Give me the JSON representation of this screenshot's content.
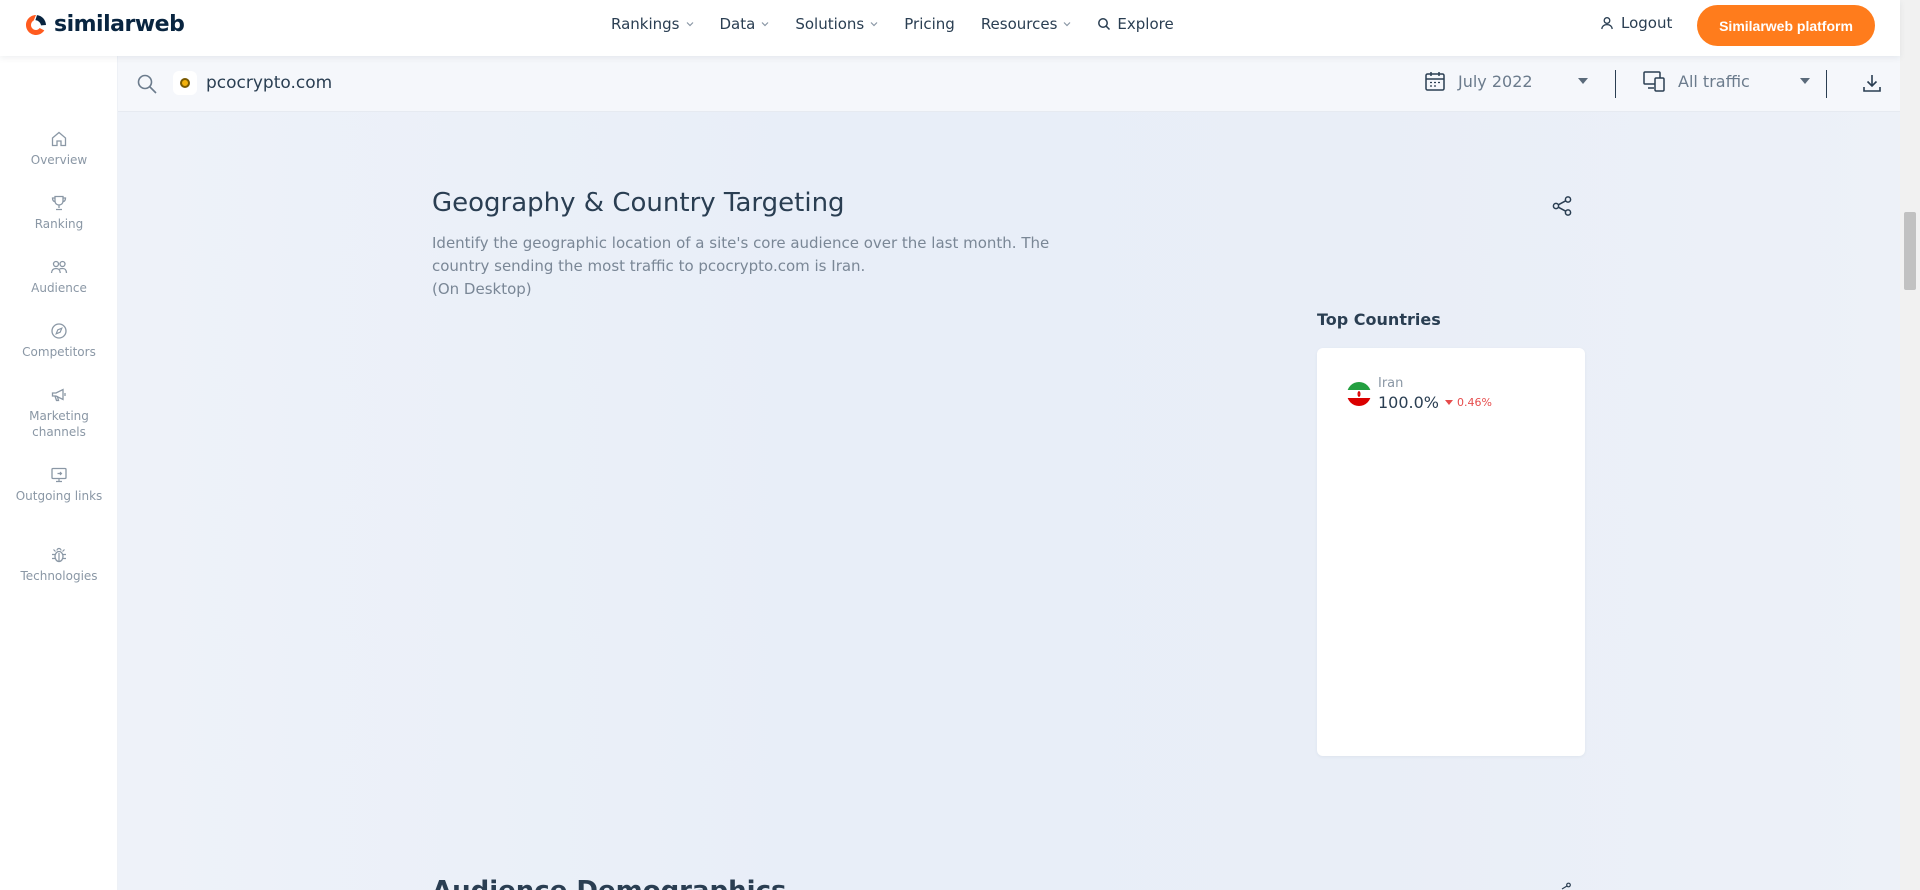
{
  "brand": {
    "name": "similarweb",
    "accent_color": "#ff7c1c",
    "logo_mark_color": "#ff5b1f"
  },
  "topnav": {
    "items": [
      {
        "label": "Rankings",
        "has_dropdown": true
      },
      {
        "label": "Data",
        "has_dropdown": true
      },
      {
        "label": "Solutions",
        "has_dropdown": true
      },
      {
        "label": "Pricing",
        "has_dropdown": false
      },
      {
        "label": "Resources",
        "has_dropdown": true
      },
      {
        "label": "Explore",
        "has_dropdown": false,
        "icon": "search-icon"
      }
    ],
    "logout_label": "Logout",
    "platform_button_label": "Similarweb platform"
  },
  "searchbar": {
    "domain": "pcocrypto.com",
    "date_range": "July 2022",
    "traffic_filter": "All traffic"
  },
  "sidebar": {
    "items": [
      {
        "label": "Overview",
        "icon": "home-icon"
      },
      {
        "label": "Ranking",
        "icon": "trophy-icon"
      },
      {
        "label": "Audience",
        "icon": "users-icon"
      },
      {
        "label": "Competitors",
        "icon": "compass-icon"
      },
      {
        "label": "Marketing channels",
        "icon": "megaphone-icon"
      },
      {
        "label": "Outgoing links",
        "icon": "monitor-link-icon"
      },
      {
        "label": "Technologies",
        "icon": "bug-icon"
      }
    ]
  },
  "geography": {
    "title": "Geography & Country Targeting",
    "description_line1": "Identify the geographic location of a site's core audience over the last month. The country sending the most traffic to pcocrypto.com is Iran.",
    "description_line2": "(On Desktop)",
    "top_countries_label": "Top Countries",
    "countries": [
      {
        "name": "Iran",
        "share": "100.0%",
        "change": "0.46%",
        "change_direction": "down",
        "change_color": "#e64c4c"
      }
    ]
  },
  "next_section": {
    "title": "Audience Demographics"
  }
}
